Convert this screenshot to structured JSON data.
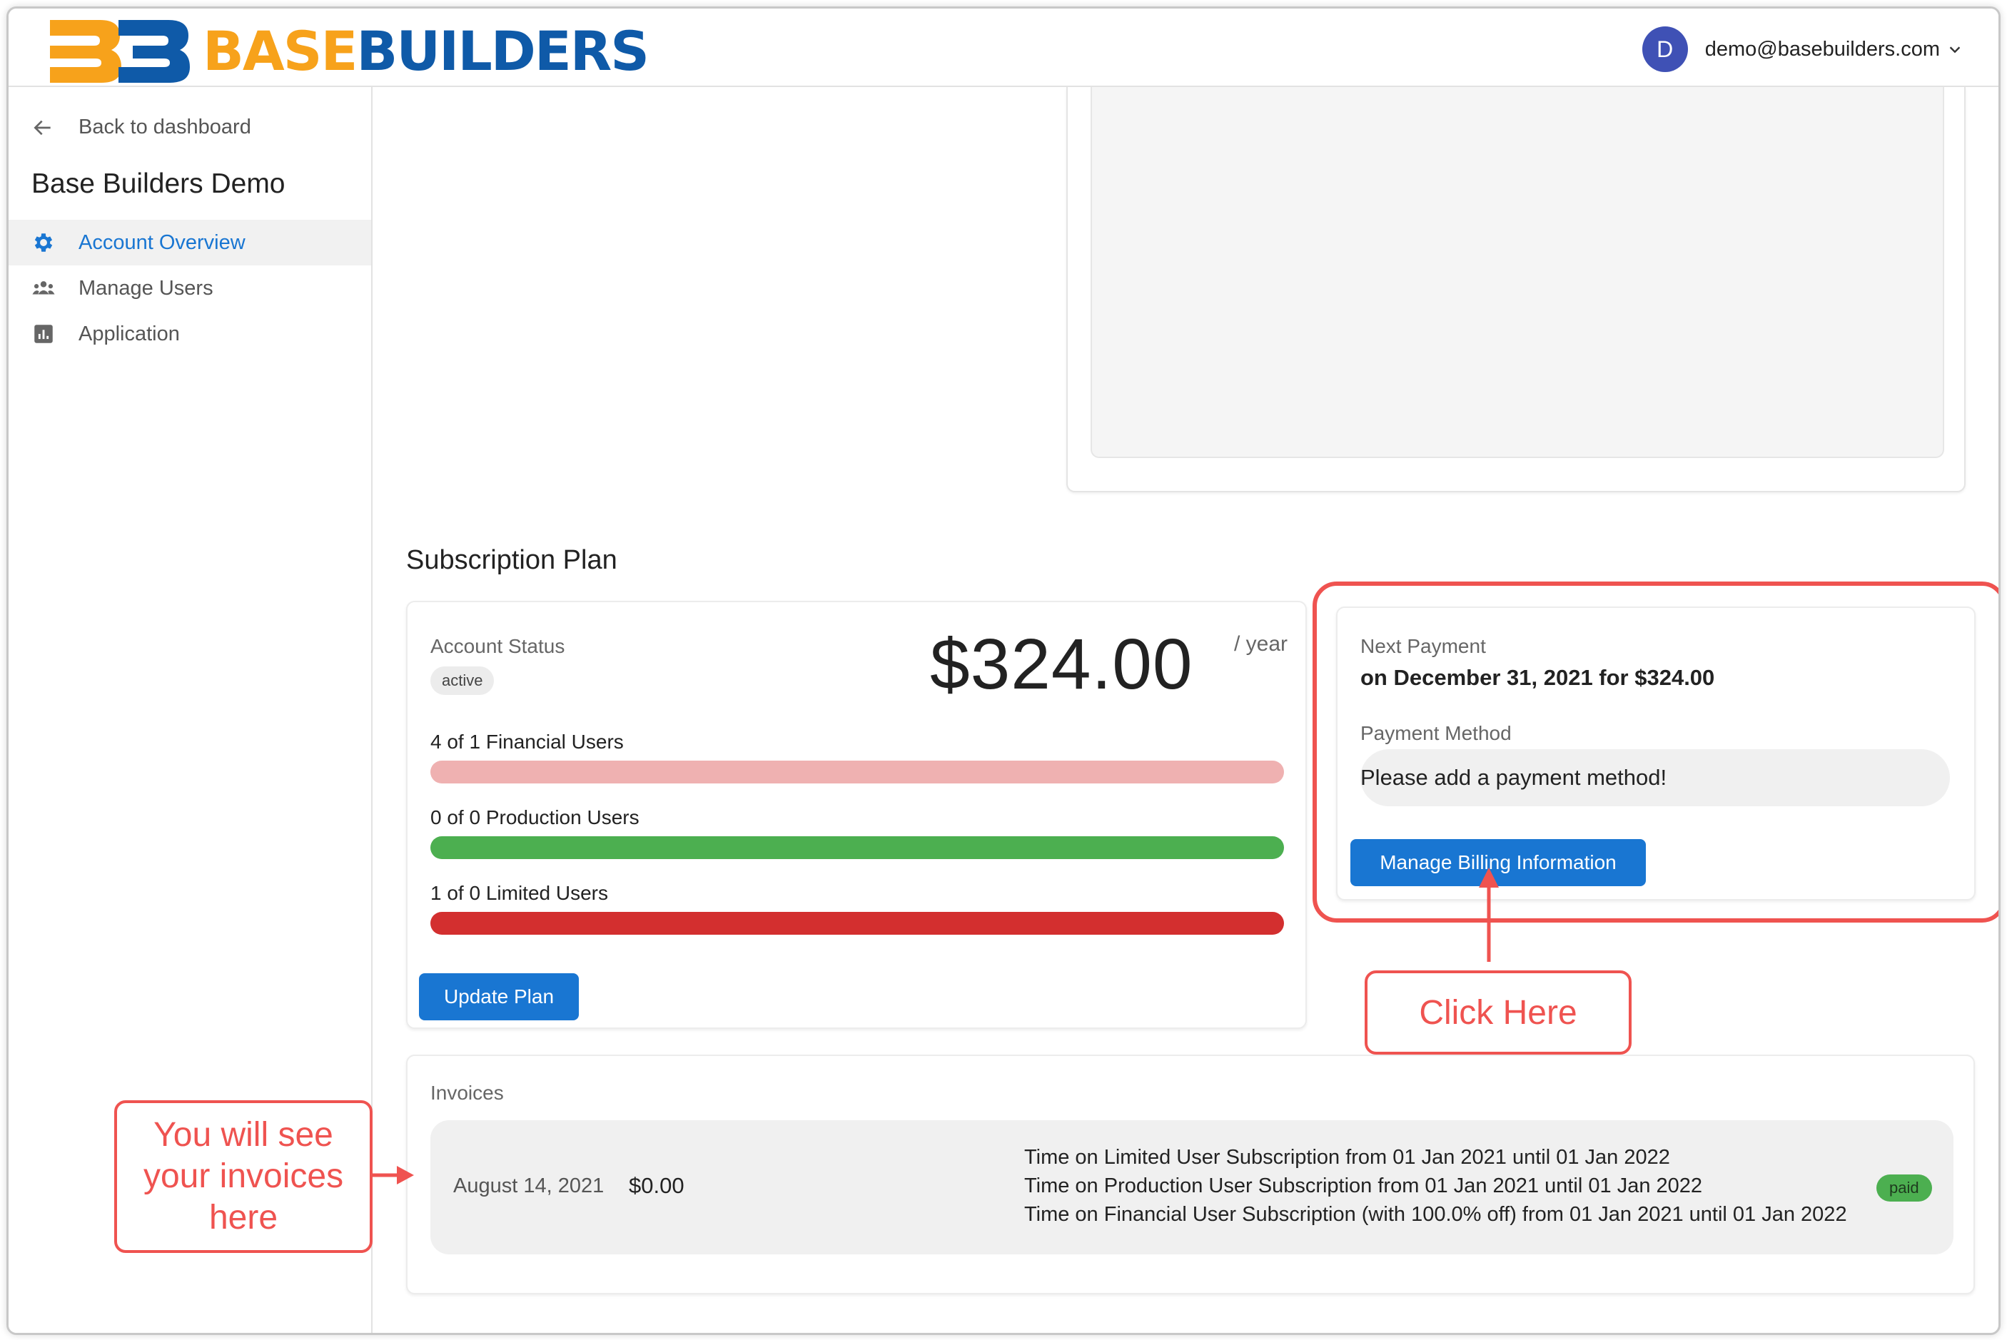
{
  "header": {
    "brand_part1": "BASE",
    "brand_part2": "BUILDERS",
    "user_initial": "D",
    "user_email": "demo@basebuilders.com"
  },
  "sidebar": {
    "back_label": "Back to dashboard",
    "org_name": "Base Builders Demo",
    "items": [
      {
        "label": "Account Overview",
        "icon": "gear-icon",
        "active": true
      },
      {
        "label": "Manage Users",
        "icon": "users-icon",
        "active": false
      },
      {
        "label": "Application",
        "icon": "chart-icon",
        "active": false
      }
    ]
  },
  "subscription": {
    "title": "Subscription Plan",
    "status_label": "Account Status",
    "status_value": "active",
    "price": "$324.00",
    "period": "/ year",
    "usage": [
      {
        "label": "4 of 1 Financial Users",
        "color": "#efb1b1"
      },
      {
        "label": "0 of 0 Production Users",
        "color": "#4caf50"
      },
      {
        "label": "1 of 0 Limited Users",
        "color": "#d32f2f"
      }
    ],
    "update_button": "Update Plan"
  },
  "payment": {
    "next_label": "Next Payment",
    "next_value": "on December 31, 2021 for $324.00",
    "method_label": "Payment Method",
    "method_value": "Please add a payment method!",
    "billing_button": "Manage Billing Information"
  },
  "invoices": {
    "label": "Invoices",
    "rows": [
      {
        "date": "August 14, 2021",
        "amount": "$0.00",
        "lines": [
          "Time on Limited User Subscription from 01 Jan 2021 until 01 Jan 2022",
          "Time on Production User Subscription from 01 Jan 2021 until 01 Jan 2022",
          "Time on Financial User Subscription (with 100.0% off) from 01 Jan 2021 until 01 Jan 2022"
        ],
        "status": "paid"
      }
    ]
  },
  "annotations": {
    "click_here": "Click Here",
    "invoice_note": "You will see your invoices here",
    "color": "#ef5350"
  },
  "colors": {
    "primary": "#1976d2",
    "brand_orange": "#f7a21b",
    "brand_blue": "#0f5aa8"
  }
}
